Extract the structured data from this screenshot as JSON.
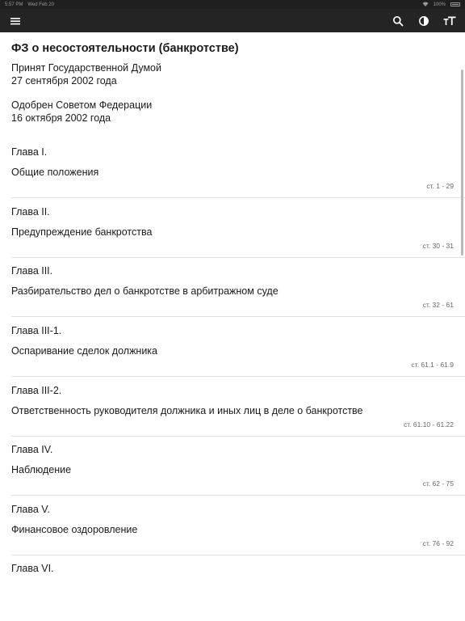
{
  "status_bar": {
    "time": "5:57 PM",
    "date": "Wed Feb 20",
    "battery": "100%"
  },
  "app_bar": {
    "icons": [
      "menu-icon",
      "search-icon",
      "contrast-icon",
      "text-size-icon"
    ],
    "icon_color": "#ffffff",
    "background": "#242424"
  },
  "document": {
    "title": "ФЗ о несостоятельности (банкротстве)",
    "adopted_line1": "Принят Государственной Думой",
    "adopted_line2": "27 сентября 2002 года",
    "approved_line1": "Одобрен Советом Федерации",
    "approved_line2": "16 октября  2002 года"
  },
  "chapters": [
    {
      "number": "Глава I.",
      "name": "Общие положения",
      "range": "ст. 1 - 29"
    },
    {
      "number": "Глава II.",
      "name": "Предупреждение банкротства",
      "range": "ст. 30 - 31"
    },
    {
      "number": "Глава III.",
      "name": "Разбирательство дел о банкротстве в арбитражном суде",
      "range": "ст. 32 - 61"
    },
    {
      "number": "Глава III-1.",
      "name": "Оспаривание сделок должника",
      "range": "ст. 61.1 - 61.9"
    },
    {
      "number": "Глава III-2.",
      "name": "Ответственность руководителя должника и иных лиц в деле о банкротстве",
      "range": "ст. 61.10 - 61.22"
    },
    {
      "number": "Глава IV.",
      "name": "Наблюдение",
      "range": "ст. 62 - 75"
    },
    {
      "number": "Глава V.",
      "name": "Финансовое оздоровление",
      "range": "ст. 76 - 92"
    },
    {
      "number": "Глава VI.",
      "name": "",
      "range": ""
    }
  ]
}
